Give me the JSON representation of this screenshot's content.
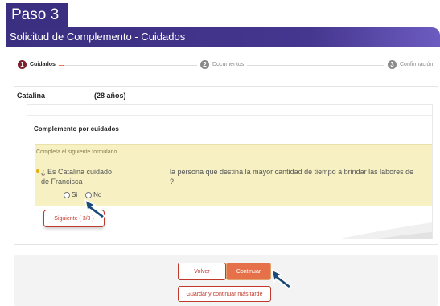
{
  "header": {
    "step_tab": "Paso 3",
    "title": "Solicitud de Complemento - Cuidados"
  },
  "progress": {
    "steps": [
      {
        "number": "1",
        "label": "Cuidados",
        "active": true
      },
      {
        "number": "2",
        "label": "Documentos",
        "active": false
      },
      {
        "number": "3",
        "label": "Confirmación",
        "active": false
      }
    ]
  },
  "person": {
    "name": "Catalina",
    "age": "(28 años)"
  },
  "section": {
    "title": "Complemento por cuidados",
    "form_hint": "Completa el siguiente formulario",
    "question_part1": "¿ Es Catalina cuidado de Francisca",
    "question_part2": "la persona que destina la mayor cantidad de tiempo a brindar las labores de ?",
    "options": [
      "Si",
      "No"
    ],
    "next_button": "Siguiente ( 3/3 )"
  },
  "footer": {
    "back_button": "Volver",
    "continue_button": "Continuar",
    "save_later_button": "Guardar y continuar más tarde"
  },
  "colors": {
    "brand_purple": "#3a2f80",
    "accent_orange": "#e6704a",
    "accent_red": "#c0392b",
    "form_bg": "#f6f0c2"
  },
  "icons": [
    "cursor-pointer-icon",
    "radio-icon"
  ]
}
